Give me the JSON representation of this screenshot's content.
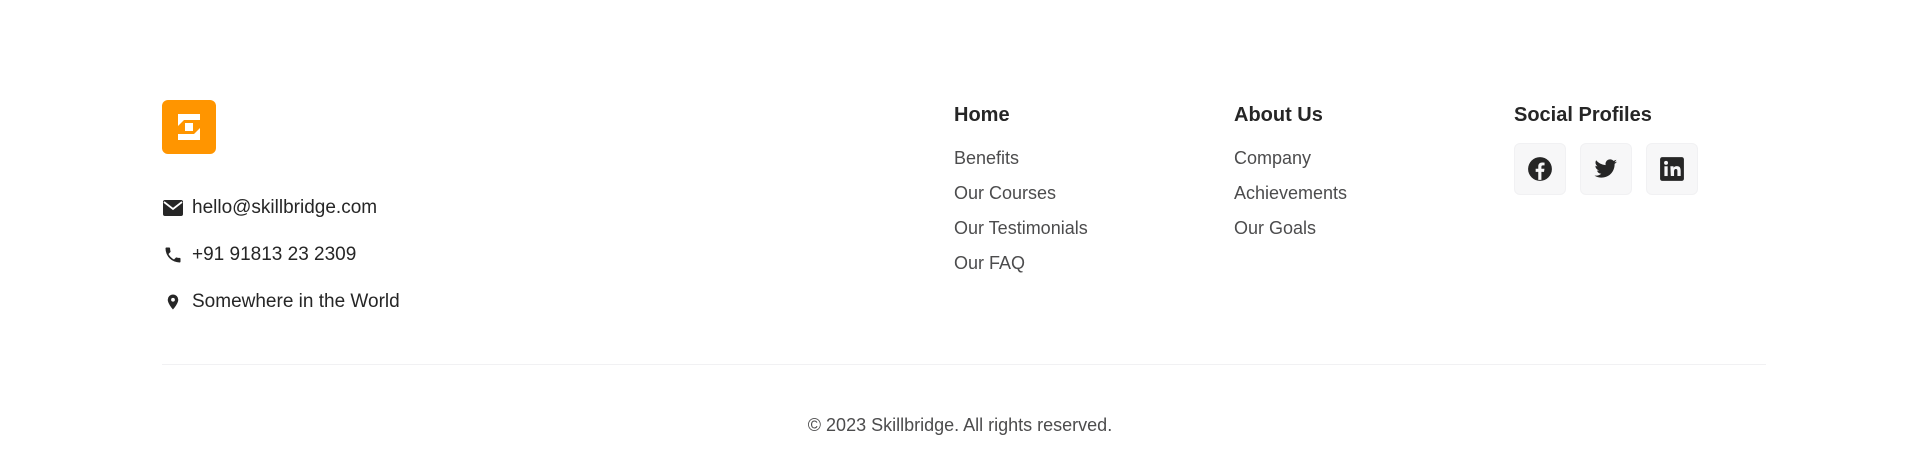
{
  "brand": {
    "logo_icon": "skillbridge-logo-icon",
    "accent_color": "#FF9500"
  },
  "contact": {
    "email": "hello@skillbridge.com",
    "email_icon": "envelope-icon",
    "phone": "+91 91813 23 2309",
    "phone_icon": "phone-icon",
    "location": "Somewhere in the World",
    "location_icon": "location-pin-icon"
  },
  "columns": {
    "home": {
      "title": "Home",
      "links": [
        "Benefits",
        "Our Courses",
        "Our Testimonials",
        "Our FAQ"
      ]
    },
    "about": {
      "title": "About Us",
      "links": [
        "Company",
        "Achievements",
        "Our Goals"
      ]
    },
    "social": {
      "title": "Social Profiles",
      "icons": [
        "facebook-icon",
        "twitter-icon",
        "linkedin-icon"
      ]
    }
  },
  "copyright": "© 2023 Skillbridge. All rights reserved."
}
